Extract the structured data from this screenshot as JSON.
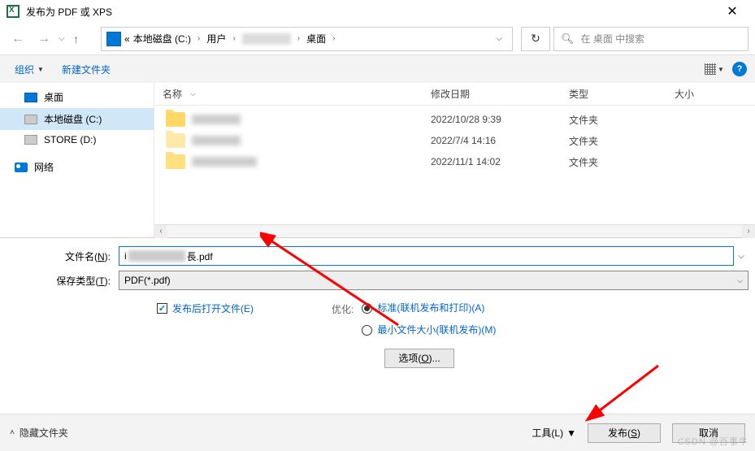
{
  "title": "发布为 PDF 或 XPS",
  "breadcrumb": {
    "prefix": "«",
    "parts": [
      "本地磁盘 (C:)",
      "用户",
      "桌面"
    ]
  },
  "refresh_icon": "↻",
  "search": {
    "placeholder": "在 桌面 中搜索"
  },
  "toolbar": {
    "organize": "组织",
    "newfolder": "新建文件夹"
  },
  "sidebar": [
    {
      "label": "桌面",
      "icon": "monitor"
    },
    {
      "label": "本地磁盘 (C:)",
      "icon": "drive",
      "selected": true
    },
    {
      "label": "STORE (D:)",
      "icon": "drive"
    },
    {
      "label": "网络",
      "icon": "network"
    }
  ],
  "columns": {
    "name": "名称",
    "date": "修改日期",
    "type": "类型",
    "size": "大小"
  },
  "rows": [
    {
      "date": "2022/10/28 9:39",
      "type": "文件夹"
    },
    {
      "date": "2022/7/4 14:16",
      "type": "文件夹"
    },
    {
      "date": "2022/11/1 14:02",
      "type": "文件夹"
    }
  ],
  "form": {
    "filename_label_pre": "文件名(",
    "filename_label_ul": "N",
    "filename_label_post": "):",
    "filename_prefix": "i",
    "filename_suffix": "長.pdf",
    "savetype_label_pre": "保存类型(",
    "savetype_label_ul": "T",
    "savetype_label_post": "):",
    "savetype_value": "PDF(*.pdf)"
  },
  "options": {
    "open_after_pre": "发布后打开文件(",
    "open_after_ul": "E",
    "open_after_post": ")",
    "optimize_label": "优化:",
    "radio_std": "标准(联机发布和打印)(A)",
    "radio_min": "最小文件大小(联机发布)(M)",
    "options_btn_pre": "选项(",
    "options_btn_ul": "O",
    "options_btn_post": ")..."
  },
  "footer": {
    "hide": "隐藏文件夹",
    "tools_pre": "工具(",
    "tools_ul": "L",
    "tools_post": ")",
    "publish_pre": "发布(",
    "publish_ul": "S",
    "publish_post": ")",
    "cancel": "取消"
  },
  "watermark": "CSDN @百事牛"
}
